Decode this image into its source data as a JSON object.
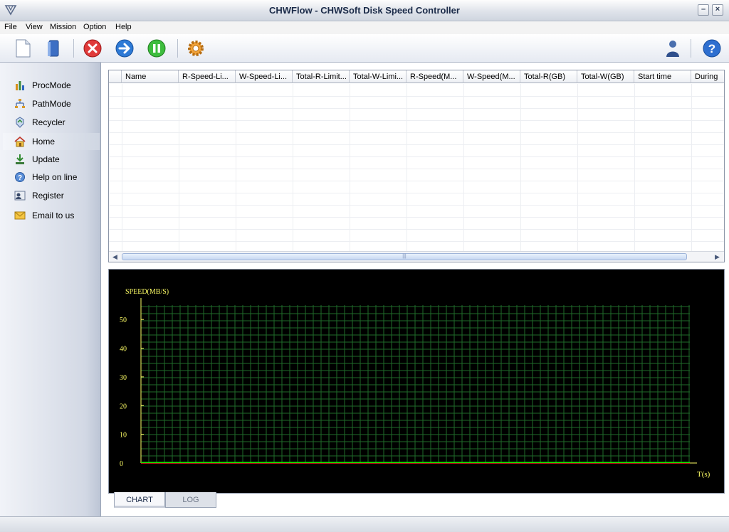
{
  "window": {
    "title": "CHWFlow - CHWSoft Disk Speed Controller",
    "minimize_label": "–",
    "close_label": "×"
  },
  "menu": {
    "items": [
      {
        "label": "File"
      },
      {
        "label": "View"
      },
      {
        "label": "Mission"
      },
      {
        "label": "Option"
      },
      {
        "label": "Help"
      }
    ]
  },
  "toolbar": {
    "buttons": [
      {
        "icon": "new-document-icon"
      },
      {
        "icon": "open-book-icon"
      },
      {
        "icon": "stop-icon"
      },
      {
        "icon": "start-arrow-icon"
      },
      {
        "icon": "pause-icon"
      },
      {
        "icon": "settings-gear-icon"
      },
      {
        "icon": "user-icon"
      },
      {
        "icon": "help-icon"
      }
    ]
  },
  "sidebar": {
    "items": [
      {
        "label": "ProcMode",
        "icon": "bar-chart-icon"
      },
      {
        "label": "PathMode",
        "icon": "path-icon"
      },
      {
        "label": "Recycler",
        "icon": "recycle-icon"
      },
      {
        "label": "Home",
        "icon": "home-icon",
        "active": true
      },
      {
        "label": "Update",
        "icon": "download-icon"
      },
      {
        "label": "Help on line",
        "icon": "help-circle-icon"
      },
      {
        "label": "Register",
        "icon": "register-icon"
      },
      {
        "label": "Email to us",
        "icon": "envelope-icon"
      }
    ]
  },
  "table": {
    "columns": [
      "Name",
      "R-Speed-Li...",
      "W-Speed-Li...",
      "Total-R-Limit...",
      "Total-W-Limi...",
      "R-Speed(M...",
      "W-Speed(M...",
      "Total-R(GB)",
      "Total-W(GB)",
      "Start time",
      "During"
    ],
    "rows": [],
    "scroll_thumb_grip": "|||"
  },
  "chart_data": {
    "type": "line",
    "ylabel": "SPEED(MB/S)",
    "xlabel": "T(s)",
    "y_ticks": [
      0,
      10,
      20,
      30,
      40,
      50
    ],
    "ylim": [
      0,
      55
    ],
    "grid": true,
    "series": [
      {
        "color": "#ff2020",
        "values": [
          0,
          0,
          0,
          0,
          0,
          0,
          0,
          0,
          0,
          0
        ]
      },
      {
        "color": "#00ff00",
        "values": [
          0,
          0,
          0,
          0,
          0,
          0,
          0,
          0,
          0,
          0
        ]
      }
    ],
    "colors": {
      "background": "#000000",
      "grid": "#1f6b2a",
      "axis": "#ffff66",
      "text": "#ffff66"
    }
  },
  "tabs": [
    {
      "label": "CHART",
      "selected": true
    },
    {
      "label": "LOG",
      "selected": false
    }
  ],
  "status": {
    "text": ""
  }
}
